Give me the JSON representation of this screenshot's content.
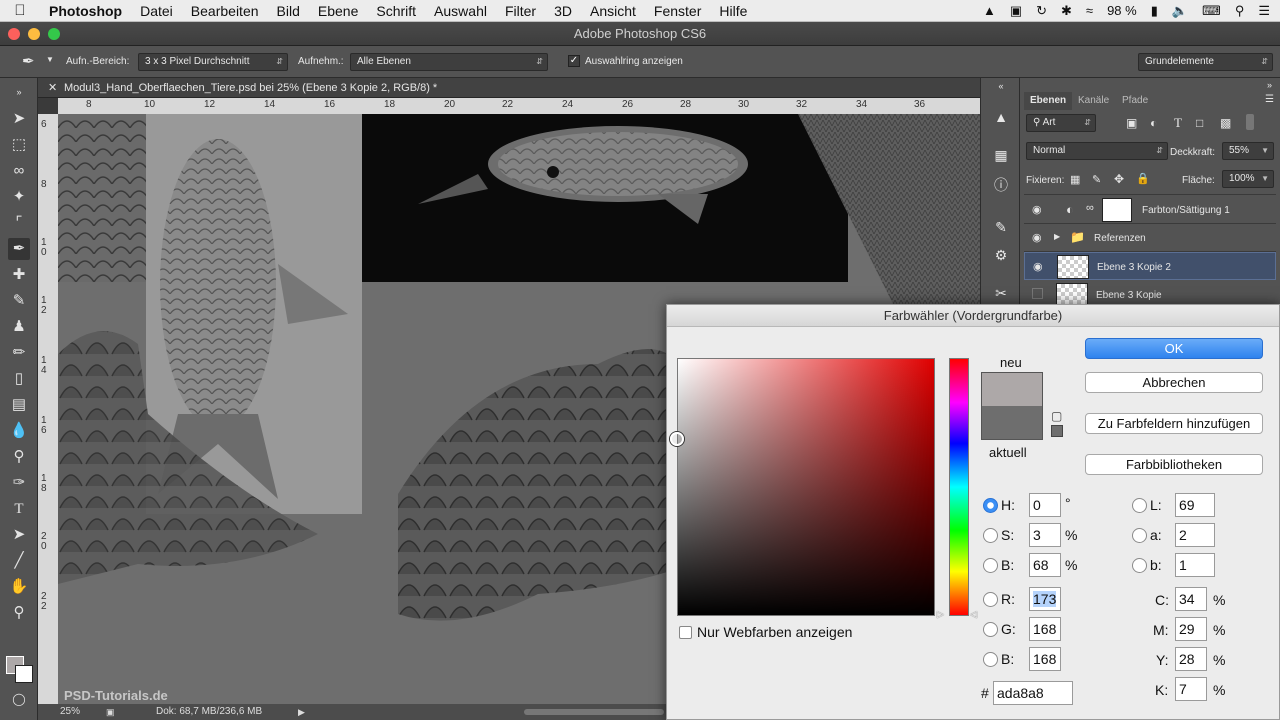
{
  "menubar": {
    "apple": "",
    "app": "Photoshop",
    "items": [
      "Datei",
      "Bearbeiten",
      "Bild",
      "Ebene",
      "Schrift",
      "Auswahl",
      "Filter",
      "3D",
      "Ansicht",
      "Fenster",
      "Hilfe"
    ],
    "battery": "98 %"
  },
  "window": {
    "title": "Adobe Photoshop CS6"
  },
  "options": {
    "sample_label": "Aufn.-Bereich:",
    "sample_value": "3 x 3 Pixel Durchschnitt",
    "source_label": "Aufnehm.:",
    "source_value": "Alle Ebenen",
    "ring_label": "Auswahlring anzeigen",
    "workspace": "Grundelemente"
  },
  "document": {
    "tab_title": "Modul3_Hand_Oberflaechen_Tiere.psd bei 25% (Ebene 3 Kopie 2, RGB/8) *",
    "ruler_top": [
      "8",
      "10",
      "12",
      "14",
      "16",
      "18",
      "20",
      "22",
      "24",
      "26",
      "28",
      "30",
      "32",
      "34",
      "36"
    ],
    "ruler_left": [
      "6",
      "8",
      "1\n0",
      "1\n2",
      "1\n4",
      "1\n6",
      "1\n8",
      "2\n0",
      "2\n2"
    ],
    "watermark": "PSD-Tutorials.de"
  },
  "status": {
    "zoom": "25%",
    "doc": "Dok: 68,7 MB/236,6 MB"
  },
  "panel": {
    "tabs": [
      "Ebenen",
      "Kanäle",
      "Pfade"
    ],
    "filter_kind": "Art",
    "blend_mode": "Normal",
    "opacity_label": "Deckkraft:",
    "opacity_value": "55%",
    "lock_label": "Fixieren:",
    "fill_label": "Fläche:",
    "fill_value": "100%",
    "layers": [
      {
        "name": "Farbton/Sättigung 1",
        "visible": true
      },
      {
        "name": "Referenzen",
        "visible": true
      },
      {
        "name": "Ebene 3 Kopie 2",
        "visible": true,
        "selected": true
      },
      {
        "name": "Ebene 3 Kopie",
        "visible": false
      }
    ]
  },
  "picker": {
    "title": "Farbwähler (Vordergrundfarbe)",
    "new_label": "neu",
    "current_label": "aktuell",
    "buttons": {
      "ok": "OK",
      "cancel": "Abbrechen",
      "add": "Zu Farbfeldern hinzufügen",
      "library": "Farbbibliotheken"
    },
    "web_only": "Nur Webfarben anzeigen",
    "hsb": {
      "h_label": "H:",
      "h": "0",
      "h_unit": "°",
      "s_label": "S:",
      "s": "3",
      "s_unit": "%",
      "b_label": "B:",
      "b": "68",
      "b_unit": "%"
    },
    "rgb": {
      "r_label": "R:",
      "r": "173",
      "g_label": "G:",
      "g": "168",
      "b_label": "B:",
      "b": "168"
    },
    "lab": {
      "l_label": "L:",
      "l": "69",
      "a_label": "a:",
      "a": "2",
      "b_label": "b:",
      "b": "1"
    },
    "cmyk": {
      "c_label": "C:",
      "c": "34",
      "m_label": "M:",
      "m": "29",
      "y_label": "Y:",
      "y": "28",
      "k_label": "K:",
      "k": "7",
      "unit": "%"
    },
    "hex_label": "#",
    "hex": "ada8a8",
    "colors": {
      "new": "#ada8a8",
      "current": "#6e6e6e",
      "field_hue": "#e00000",
      "ok_blue": "#3a8ff5"
    }
  }
}
